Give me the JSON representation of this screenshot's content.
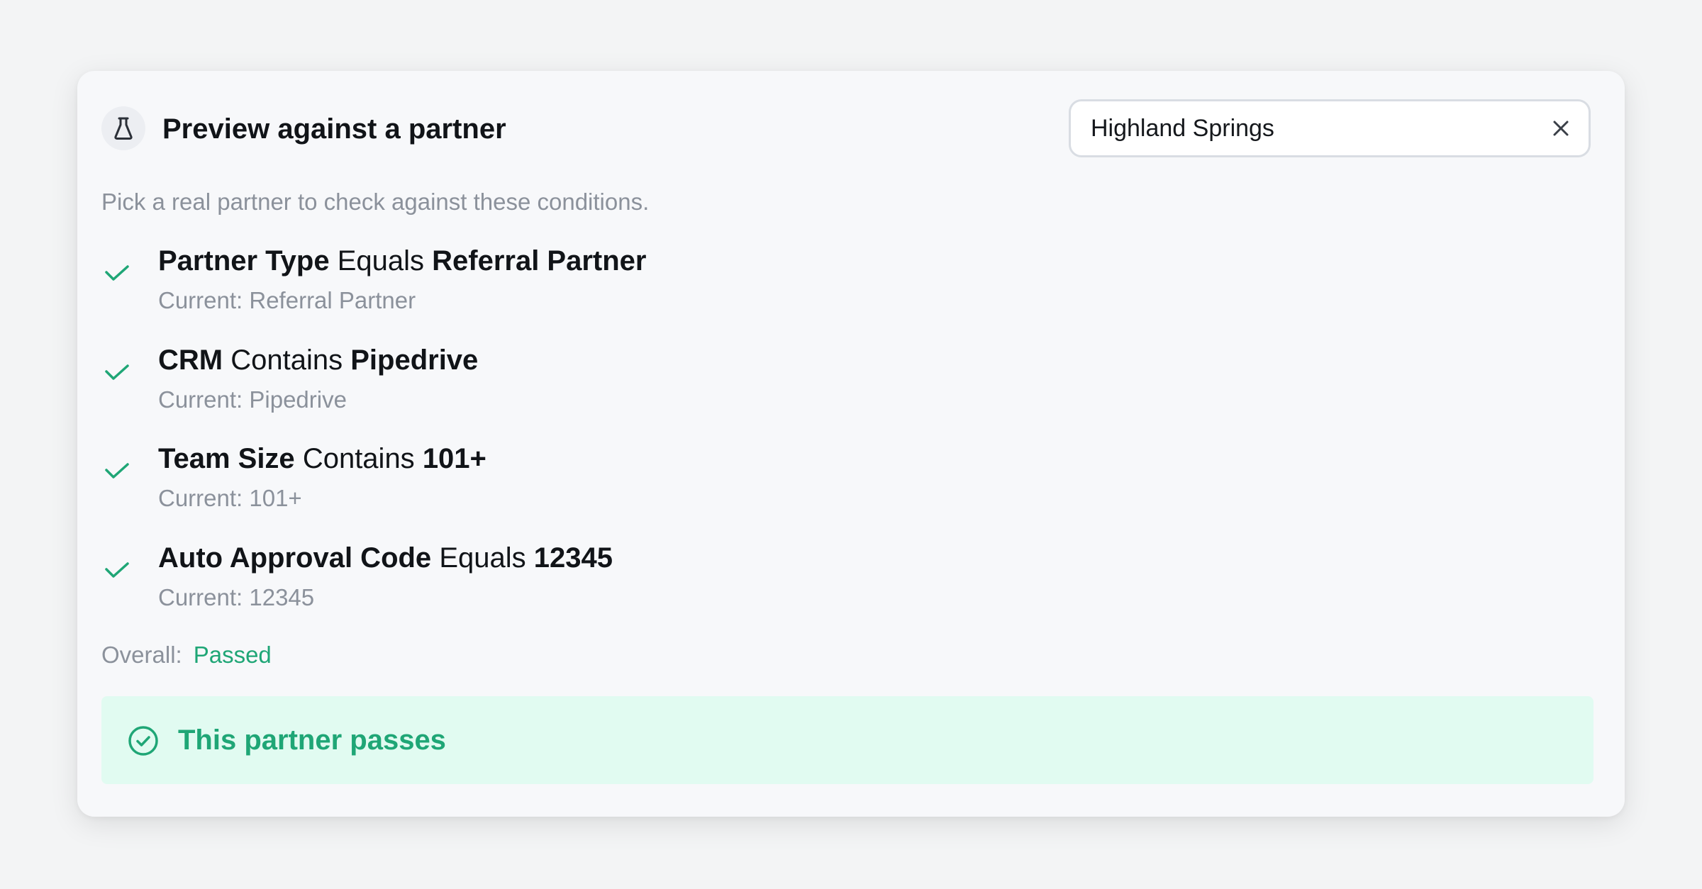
{
  "header": {
    "title": "Preview against a partner",
    "icon": "flask-icon"
  },
  "search": {
    "value": "Highland Springs",
    "placeholder": "",
    "clear_icon": "close-icon"
  },
  "subtitle": "Pick a real partner to check against these conditions.",
  "conditions": [
    {
      "field": "Partner Type",
      "operator": "Equals",
      "value": "Referral Partner",
      "current": "Current: Referral Partner",
      "passed": true
    },
    {
      "field": "CRM",
      "operator": "Contains",
      "value": "Pipedrive",
      "current": "Current: Pipedrive",
      "passed": true
    },
    {
      "field": "Team Size",
      "operator": "Contains",
      "value": "101+",
      "current": "Current: 101+",
      "passed": true
    },
    {
      "field": "Auto Approval Code",
      "operator": "Equals",
      "value": "12345",
      "current": "Current: 12345",
      "passed": true
    }
  ],
  "overall": {
    "label": "Overall:",
    "status": "Passed"
  },
  "banner": {
    "text": "This partner passes",
    "icon": "check-circle-icon"
  },
  "colors": {
    "success": "#1fa676",
    "success_bg": "#e1fbf1",
    "muted_text": "#8b919b",
    "primary_text": "#111418"
  }
}
